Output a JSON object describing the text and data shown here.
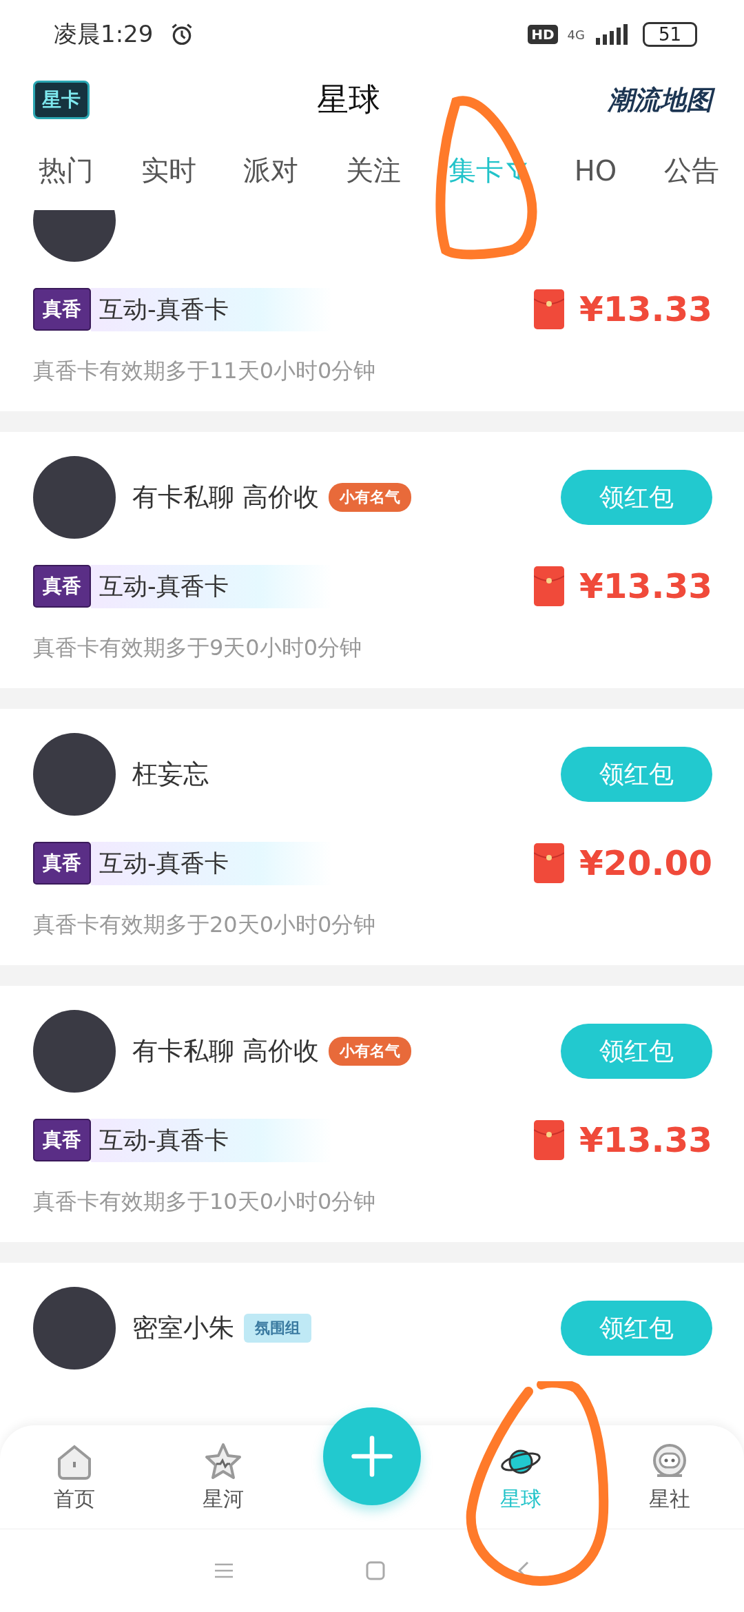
{
  "status_bar": {
    "time": "凌晨1:29",
    "hd": "HD",
    "network": "4G",
    "battery": "51"
  },
  "header": {
    "left_logo": "星卡",
    "title": "星球",
    "right_logo": "潮流地图"
  },
  "tabs": [
    {
      "label": "热门",
      "selected": false,
      "filter": false,
      "circled": false
    },
    {
      "label": "实时",
      "selected": false,
      "filter": false,
      "circled": false
    },
    {
      "label": "派对",
      "selected": false,
      "filter": false,
      "circled": false
    },
    {
      "label": "关注",
      "selected": false,
      "filter": false,
      "circled": false
    },
    {
      "label": "集卡",
      "selected": true,
      "filter": true,
      "circled": true
    },
    {
      "label": "HO",
      "selected": false,
      "filter": false,
      "circled": false
    },
    {
      "label": "公告",
      "selected": false,
      "filter": false,
      "circled": false
    }
  ],
  "posts": [
    {
      "card_tag": "真香",
      "card_name": "互动-真香卡",
      "amount": "¥13.33",
      "expiry": "真香卡有效期多于11天0小时0分钟"
    },
    {
      "name": "有卡私聊 高价收",
      "badge": {
        "kind": "fame",
        "text": "小有名气"
      },
      "button": "领红包",
      "card_tag": "真香",
      "card_name": "互动-真香卡",
      "amount": "¥13.33",
      "expiry": "真香卡有效期多于9天0小时0分钟"
    },
    {
      "name": "枉妄忘",
      "button": "领红包",
      "card_tag": "真香",
      "card_name": "互动-真香卡",
      "amount": "¥20.00",
      "expiry": "真香卡有效期多于20天0小时0分钟"
    },
    {
      "name": "有卡私聊 高价收",
      "badge": {
        "kind": "fame",
        "text": "小有名气"
      },
      "button": "领红包",
      "card_tag": "真香",
      "card_name": "互动-真香卡",
      "amount": "¥13.33",
      "expiry": "真香卡有效期多于10天0小时0分钟"
    },
    {
      "name": "密室小朱",
      "badge": {
        "kind": "crew",
        "text": "氛围组"
      },
      "button": "领红包"
    }
  ],
  "bottom_nav": [
    {
      "label": "首页",
      "selected": false,
      "circled": false
    },
    {
      "label": "星河",
      "selected": false,
      "circled": false
    },
    {
      "label": "星球",
      "selected": true,
      "circled": true
    },
    {
      "label": "星社",
      "selected": false,
      "circled": false
    }
  ]
}
